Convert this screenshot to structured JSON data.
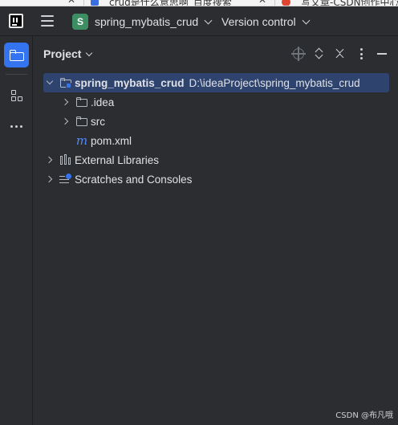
{
  "browser": {
    "tab1_text": "crud是什么意思啊_百度搜索",
    "tab2_text": "写文章-CSDN创作中心"
  },
  "titlebar": {
    "project_badge": "S",
    "project_name": "spring_mybatis_crud",
    "vcs_label": "Version control"
  },
  "project_panel": {
    "title": "Project",
    "tree": [
      {
        "label": "spring_mybatis_crud",
        "path": "D:\\ideaProject\\spring_mybatis_crud",
        "expanded": true,
        "selected": true,
        "icon": "module-folder-icon"
      },
      {
        "label": ".idea",
        "icon": "folder-icon",
        "expanded": false
      },
      {
        "label": "src",
        "icon": "folder-icon",
        "expanded": false
      },
      {
        "label": "pom.xml",
        "icon": "maven-icon"
      },
      {
        "label": "External Libraries",
        "icon": "library-icon",
        "expanded": false
      },
      {
        "label": "Scratches and Consoles",
        "icon": "scratches-icon",
        "expanded": false
      }
    ]
  },
  "watermark": "CSDN @布凡哦",
  "colors": {
    "background": "#2b2d30",
    "accent": "#3574f0",
    "selection": "#2e436e",
    "project_badge": "#3e8e64"
  }
}
